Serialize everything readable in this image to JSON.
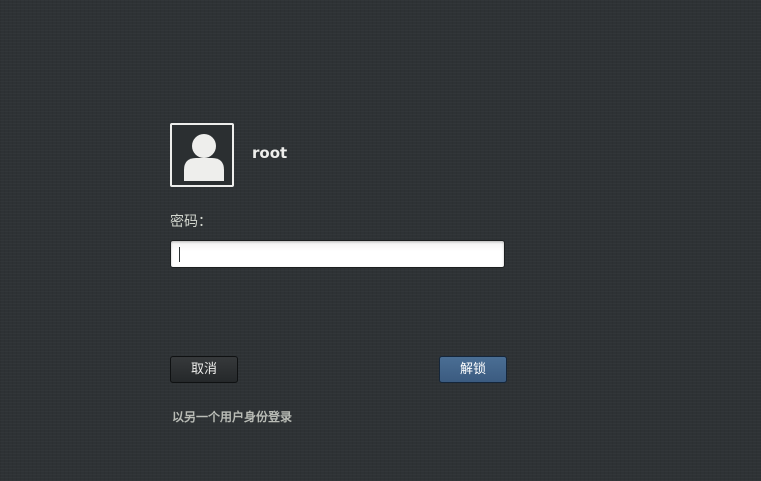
{
  "user": {
    "name": "root",
    "avatar_icon": "user-avatar-icon"
  },
  "password": {
    "label": "密码：",
    "value": "",
    "placeholder": ""
  },
  "buttons": {
    "cancel_label": "取消",
    "unlock_label": "解锁"
  },
  "switch_user_label": "以另一个用户身份登录",
  "colors": {
    "background": "#2e3235",
    "accent": "#3b5b80",
    "text": "#eeeeec"
  }
}
